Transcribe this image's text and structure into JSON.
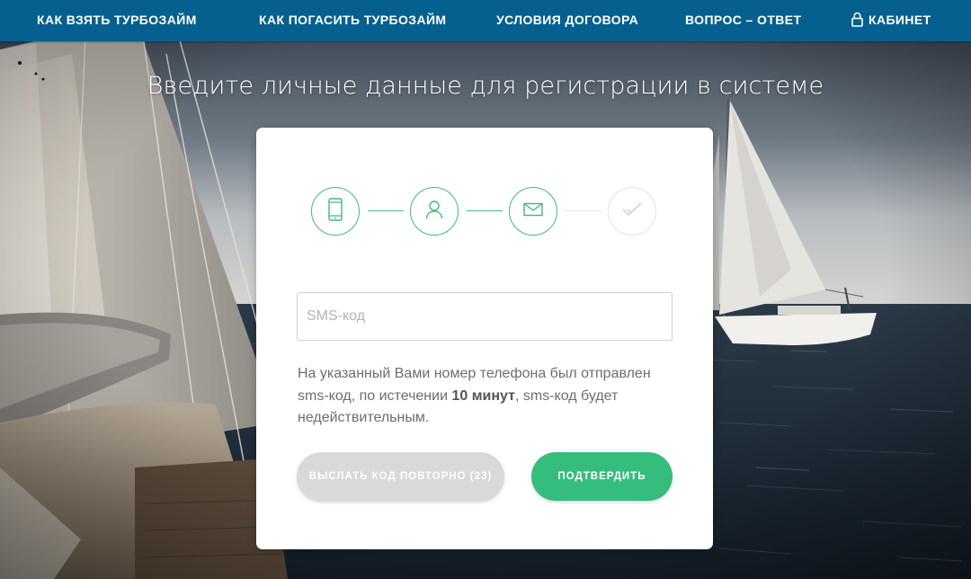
{
  "nav": {
    "items": [
      {
        "label": "КАК ВЗЯТЬ ТУРБОЗАЙМ"
      },
      {
        "label": "КАК ПОГАСИТЬ ТУРБОЗАЙМ"
      },
      {
        "label": "УСЛОВИЯ ДОГОВОРА"
      },
      {
        "label": "ВОПРОС – ОТВЕТ"
      }
    ],
    "cabinet_label": "КАБИНЕТ",
    "cabinet_icon": "lock-icon",
    "background_color": "#05608f"
  },
  "page": {
    "title": "Введите личные данные для регистрации в системе"
  },
  "steps": [
    {
      "icon": "phone-icon",
      "state": "done"
    },
    {
      "icon": "user-icon",
      "state": "done"
    },
    {
      "icon": "envelope-icon",
      "state": "current"
    },
    {
      "icon": "check-icon",
      "state": "pending"
    }
  ],
  "form": {
    "sms_placeholder": "SMS-код",
    "sms_value": "",
    "info_part1": "На указанный Вами номер телефона был отправлен sms-код, по истечении ",
    "info_bold": "10 минут",
    "info_part2": ", sms-код будет недействительным.",
    "resend_label": "ВЫСЛАТЬ КОД ПОВТОРНО (23)",
    "confirm_label": "ПОДТВЕРДИТЬ"
  },
  "colors": {
    "accent_green": "#35bd7d",
    "disabled_gray": "#d9d9d9",
    "inactive_step": "#e3e3e3"
  }
}
